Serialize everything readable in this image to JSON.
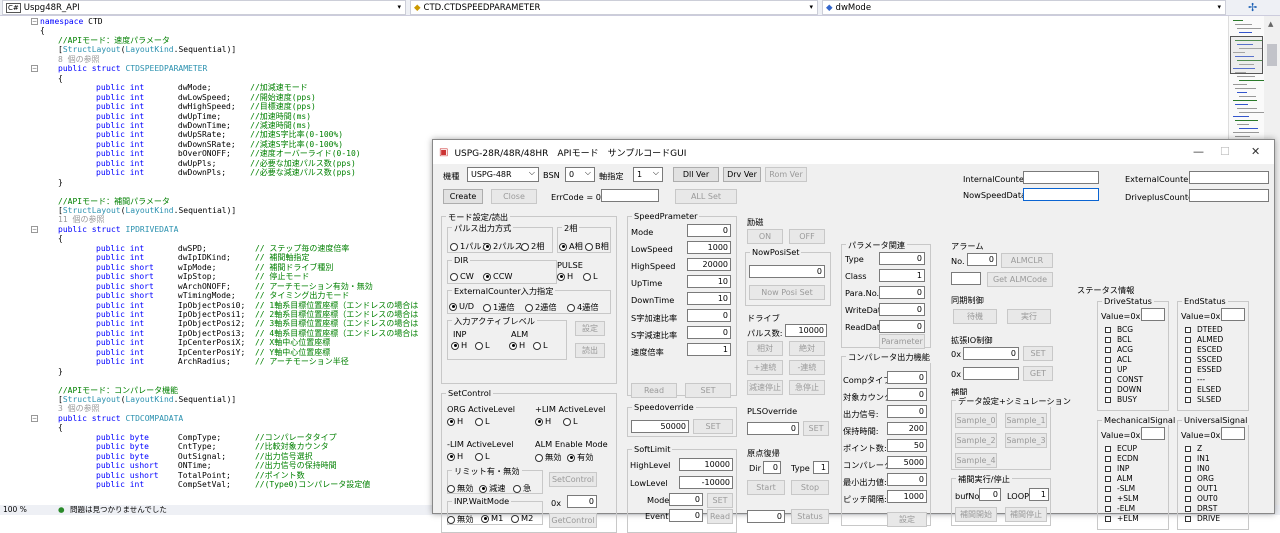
{
  "ide": {
    "project_dropdown": "Uspg48R_API",
    "class_dropdown": "CTD.CTDSPEEDPARAMETER",
    "member_dropdown": "dwMode",
    "zoom": "100 %",
    "status_text": "問題は見つかりませんでした"
  },
  "code": [
    {
      "y": 0,
      "parts": [
        [
          "kw",
          "namespace"
        ],
        [
          "",
          "CTD"
        ]
      ],
      "ind": 0
    },
    {
      "y": 1,
      "parts": [
        [
          "",
          "{"
        ]
      ],
      "ind": 0
    },
    {
      "y": 2,
      "parts": [
        [
          "cm",
          "//APIモード：速度パラメータ"
        ]
      ],
      "ind": 1
    },
    {
      "y": 3,
      "parts": [
        [
          "",
          "["
        ],
        [
          "ty",
          "StructLayout"
        ],
        [
          "",
          "("
        ],
        [
          "ty",
          "LayoutKind"
        ],
        [
          "",
          ".Sequential)]"
        ]
      ],
      "ind": 1
    },
    {
      "y": 4,
      "parts": [
        [
          "ref",
          "8 個の参照"
        ]
      ],
      "ind": 1
    },
    {
      "y": 5,
      "parts": [
        [
          "kw",
          "public struct"
        ],
        [
          "ty",
          "CTDSPEEDPARAMETER"
        ]
      ],
      "ind": 1
    },
    {
      "y": 6,
      "parts": [
        [
          "",
          "{"
        ]
      ],
      "ind": 1
    },
    {
      "y": 7,
      "parts": [
        [
          "kw",
          "public int"
        ],
        [
          "",
          "      dwMode;        "
        ],
        [
          "cm",
          "//加減速モード"
        ]
      ],
      "ind": 2
    },
    {
      "y": 8,
      "parts": [
        [
          "kw",
          "public int"
        ],
        [
          "",
          "      dwLowSpeed;    "
        ],
        [
          "cm",
          "//開始速度(pps)"
        ]
      ],
      "ind": 2
    },
    {
      "y": 9,
      "parts": [
        [
          "kw",
          "public int"
        ],
        [
          "",
          "      dwHighSpeed;   "
        ],
        [
          "cm",
          "//目標速度(pps)"
        ]
      ],
      "ind": 2
    },
    {
      "y": 10,
      "parts": [
        [
          "kw",
          "public int"
        ],
        [
          "",
          "      dwUpTime;      "
        ],
        [
          "cm",
          "//加速時間(ms)"
        ]
      ],
      "ind": 2
    },
    {
      "y": 11,
      "parts": [
        [
          "kw",
          "public int"
        ],
        [
          "",
          "      dwDownTime;    "
        ],
        [
          "cm",
          "//減速時間(ms)"
        ]
      ],
      "ind": 2
    },
    {
      "y": 12,
      "parts": [
        [
          "kw",
          "public int"
        ],
        [
          "",
          "      dwUpSRate;     "
        ],
        [
          "cm",
          "//加速S字比率(0-100%)"
        ]
      ],
      "ind": 2
    },
    {
      "y": 13,
      "parts": [
        [
          "kw",
          "public int"
        ],
        [
          "",
          "      dwDownSRate;   "
        ],
        [
          "cm",
          "//減速S字比率(0-100%)"
        ]
      ],
      "ind": 2
    },
    {
      "y": 14,
      "parts": [
        [
          "kw",
          "public int"
        ],
        [
          "",
          "      bOverONOFF;    "
        ],
        [
          "cm",
          "//速度オーバーライド(0-10)"
        ]
      ],
      "ind": 2
    },
    {
      "y": 15,
      "parts": [
        [
          "kw",
          "public int"
        ],
        [
          "",
          "      dwUpPls;       "
        ],
        [
          "cm",
          "//必要な加速パルス数(pps)"
        ]
      ],
      "ind": 2
    },
    {
      "y": 16,
      "parts": [
        [
          "kw",
          "public int"
        ],
        [
          "",
          "      dwDownPls;     "
        ],
        [
          "cm",
          "//必要な減速パルス数(pps)"
        ]
      ],
      "ind": 2
    },
    {
      "y": 17,
      "parts": [
        [
          "",
          "}"
        ]
      ],
      "ind": 1
    },
    {
      "y": 19,
      "parts": [
        [
          "cm",
          "//APIモード：補間パラメータ"
        ]
      ],
      "ind": 1
    },
    {
      "y": 20,
      "parts": [
        [
          "",
          "["
        ],
        [
          "ty",
          "StructLayout"
        ],
        [
          "",
          "("
        ],
        [
          "ty",
          "LayoutKind"
        ],
        [
          "",
          ".Sequential)]"
        ]
      ],
      "ind": 1
    },
    {
      "y": 21,
      "parts": [
        [
          "ref",
          "11 個の参照"
        ]
      ],
      "ind": 1
    },
    {
      "y": 22,
      "parts": [
        [
          "kw",
          "public struct"
        ],
        [
          "ty",
          "IPDRIVEDATA"
        ]
      ],
      "ind": 1
    },
    {
      "y": 23,
      "parts": [
        [
          "",
          "{"
        ]
      ],
      "ind": 1
    },
    {
      "y": 24,
      "parts": [
        [
          "kw",
          "public int"
        ],
        [
          "",
          "      dwSPD;          "
        ],
        [
          "cm",
          "// ステップ毎の速度倍率"
        ]
      ],
      "ind": 2
    },
    {
      "y": 25,
      "parts": [
        [
          "kw",
          "public int"
        ],
        [
          "",
          "      dwIpIDKind;     "
        ],
        [
          "cm",
          "// 補間軸指定"
        ]
      ],
      "ind": 2
    },
    {
      "y": 26,
      "parts": [
        [
          "kw",
          "public short"
        ],
        [
          "",
          "    wIpMode;        "
        ],
        [
          "cm",
          "// 補間ドライブ種別"
        ]
      ],
      "ind": 2
    },
    {
      "y": 27,
      "parts": [
        [
          "kw",
          "public short"
        ],
        [
          "",
          "    wIpStop;        "
        ],
        [
          "cm",
          "// 停止モード"
        ]
      ],
      "ind": 2
    },
    {
      "y": 28,
      "parts": [
        [
          "kw",
          "public short"
        ],
        [
          "",
          "    wArchONOFF;     "
        ],
        [
          "cm",
          "// アーチモーション有効・無効"
        ]
      ],
      "ind": 2
    },
    {
      "y": 29,
      "parts": [
        [
          "kw",
          "public short"
        ],
        [
          "",
          "    wTimingMode;    "
        ],
        [
          "cm",
          "// タイミング出力モード"
        ]
      ],
      "ind": 2
    },
    {
      "y": 30,
      "parts": [
        [
          "kw",
          "public int"
        ],
        [
          "",
          "      IpObjectPosi0;  "
        ],
        [
          "cm",
          "// 1軸系目標位置座標（エンドレスの場合は"
        ]
      ],
      "ind": 2
    },
    {
      "y": 31,
      "parts": [
        [
          "kw",
          "public int"
        ],
        [
          "",
          "      IpObjectPosi1;  "
        ],
        [
          "cm",
          "// 2軸系目標位置座標（エンドレスの場合は"
        ]
      ],
      "ind": 2
    },
    {
      "y": 32,
      "parts": [
        [
          "kw",
          "public int"
        ],
        [
          "",
          "      IpObjectPosi2;  "
        ],
        [
          "cm",
          "// 3軸系目標位置座標（エンドレスの場合は"
        ]
      ],
      "ind": 2
    },
    {
      "y": 33,
      "parts": [
        [
          "kw",
          "public int"
        ],
        [
          "",
          "      IpObjectPosi3;  "
        ],
        [
          "cm",
          "// 4軸系目標位置座標（エンドレスの場合は"
        ]
      ],
      "ind": 2
    },
    {
      "y": 34,
      "parts": [
        [
          "kw",
          "public int"
        ],
        [
          "",
          "      IpCenterPosiX;  "
        ],
        [
          "cm",
          "// X軸中心位置座標"
        ]
      ],
      "ind": 2
    },
    {
      "y": 35,
      "parts": [
        [
          "kw",
          "public int"
        ],
        [
          "",
          "      IpCenterPosiY;  "
        ],
        [
          "cm",
          "// Y軸中心位置座標"
        ]
      ],
      "ind": 2
    },
    {
      "y": 36,
      "parts": [
        [
          "kw",
          "public int"
        ],
        [
          "",
          "      ArchRadius;     "
        ],
        [
          "cm",
          "// アーチモーション半径"
        ]
      ],
      "ind": 2
    },
    {
      "y": 37,
      "parts": [
        [
          "",
          "}"
        ]
      ],
      "ind": 1
    },
    {
      "y": 39,
      "parts": [
        [
          "cm",
          "//APIモード：コンパレータ機能"
        ]
      ],
      "ind": 1
    },
    {
      "y": 40,
      "parts": [
        [
          "",
          "["
        ],
        [
          "ty",
          "StructLayout"
        ],
        [
          "",
          "("
        ],
        [
          "ty",
          "LayoutKind"
        ],
        [
          "",
          ".Sequential)]"
        ]
      ],
      "ind": 1
    },
    {
      "y": 41,
      "parts": [
        [
          "ref",
          "3 個の参照"
        ]
      ],
      "ind": 1
    },
    {
      "y": 42,
      "parts": [
        [
          "kw",
          "public struct"
        ],
        [
          "ty",
          "CTDCOMPADATA"
        ]
      ],
      "ind": 1
    },
    {
      "y": 43,
      "parts": [
        [
          "",
          "{"
        ]
      ],
      "ind": 1
    },
    {
      "y": 44,
      "parts": [
        [
          "kw",
          "public byte"
        ],
        [
          "",
          "     CompType;       "
        ],
        [
          "cm",
          "//コンパレータタイプ"
        ]
      ],
      "ind": 2
    },
    {
      "y": 45,
      "parts": [
        [
          "kw",
          "public byte"
        ],
        [
          "",
          "     CntType;        "
        ],
        [
          "cm",
          "//比較対象カウンタ"
        ]
      ],
      "ind": 2
    },
    {
      "y": 46,
      "parts": [
        [
          "kw",
          "public byte"
        ],
        [
          "",
          "     OutSignal;      "
        ],
        [
          "cm",
          "//出力信号選択"
        ]
      ],
      "ind": 2
    },
    {
      "y": 47,
      "parts": [
        [
          "kw",
          "public ushort"
        ],
        [
          "",
          "   ONTime;         "
        ],
        [
          "cm",
          "//出力信号の保持時間"
        ]
      ],
      "ind": 2
    },
    {
      "y": 48,
      "parts": [
        [
          "kw",
          "public ushort"
        ],
        [
          "",
          "   TotalPoint;     "
        ],
        [
          "cm",
          "//ポイント数"
        ]
      ],
      "ind": 2
    },
    {
      "y": 49,
      "parts": [
        [
          "kw",
          "public int"
        ],
        [
          "",
          "      CompSetVal;     "
        ],
        [
          "cm",
          "//(Type0)コンパレータ設定値"
        ]
      ],
      "ind": 2
    }
  ],
  "app": {
    "title": "USPG-28R/48R/48HR　APIモード　サンプルコードGUI",
    "model_label": "機種",
    "model_value": "USPG-48R",
    "bsn_label": "BSN",
    "bsn_value": "0",
    "axis_label": "軸指定",
    "axis_value": "1",
    "dll_ver": "Dll Ver",
    "drv_ver": "Drv Ver",
    "rom_ver": "Rom Ver",
    "create": "Create",
    "close": "Close",
    "errcode_label": "ErrCode = 0x",
    "all_set": "ALL Set",
    "internal_counter": "InternalCounter",
    "external_counter": "ExternalCounter",
    "now_speed_data": "NowSpeedData",
    "driveplus_counter": "DriveplusCounter",
    "mode_group": "モード設定/読出",
    "pulse_group": "パルス出力方式",
    "pulse_opts": [
      "1パルス",
      "2パルス",
      "2相"
    ],
    "phase2_group": "2相",
    "phase2_opts": [
      "A相",
      "B相"
    ],
    "dir_group": "DIR",
    "dir_opts": [
      "CW",
      "CCW"
    ],
    "pulse_lbl": "PULSE",
    "hl": [
      "H",
      "L"
    ],
    "ext_group": "ExternalCounter入力指定",
    "ext_opts": [
      "U/D",
      "1逓倍",
      "2逓倍",
      "4逓倍"
    ],
    "active_group": "入力アクティブレベル",
    "inp": "INP",
    "alm": "ALM",
    "set_jp": "設定",
    "read_jp": "読出",
    "setcontrol_group": "SetControl",
    "org_active": "ORG ActiveLevel",
    "plim_active": "+LIM ActiveLevel",
    "mlim_active": "-LIM ActiveLevel",
    "alm_enable": "ALM Enable Mode",
    "alm_enable_opts": [
      "無効",
      "有効"
    ],
    "limit_group": "リミット有・無効",
    "limit_opts": [
      "無効",
      "減速",
      "急"
    ],
    "setcontrol_btn": "SetControl",
    "zero_x": "0x",
    "zero_x_val": "0",
    "inpwait_group": "INP.WaitMode",
    "inpwait_opts": [
      "無効",
      "M1",
      "M2"
    ],
    "getcontrol_btn": "GetControl",
    "speed_group": "SpeedPrameter",
    "speed_fields": [
      {
        "label": "Mode",
        "value": "0"
      },
      {
        "label": "LowSpeed",
        "value": "1000"
      },
      {
        "label": "HighSpeed",
        "value": "20000"
      },
      {
        "label": "UpTime",
        "value": "10"
      },
      {
        "label": "DownTime",
        "value": "10"
      },
      {
        "label": "S字加速比率",
        "value": "0"
      },
      {
        "label": "S字減速比率",
        "value": "0"
      },
      {
        "label": "速度倍率",
        "value": "1"
      }
    ],
    "read": "Read",
    "set": "SET",
    "override_group": "Speedoverride",
    "override_value": "50000",
    "softlimit_group": "SoftLimit",
    "highlevel_label": "HighLevel",
    "highlevel_value": "10000",
    "lowlevel_label": "LowLevel",
    "lowlevel_value": "-10000",
    "sl_mode_label": "Mode",
    "sl_mode_value": "0",
    "sl_event_label": "Event",
    "sl_event_value": "0",
    "excite_group": "励磁",
    "on": "ON",
    "off": "OFF",
    "nowposi_group": "NowPosiSet",
    "nowposi_value": "0",
    "nowposi_btn": "Now Posi Set",
    "drive_group": "ドライブ",
    "pulse_count_label": "パルス数:",
    "pulse_count_value": "10000",
    "relative": "相対",
    "absolute": "絶対",
    "plus_cont": "+連続",
    "minus_cont": "-連続",
    "decel_stop": "減速停止",
    "emerg_stop": "急停止",
    "plsoverride_group": "PLSOverride",
    "plsoverride_value": "0",
    "origin_group": "原点復帰",
    "dir_short": "Dir",
    "dir_val": "0",
    "type_label": "Type",
    "type_val": "1",
    "start": "Start",
    "stop": "Stop",
    "status_val": "0",
    "status_btn": "Status",
    "param_group": "パラメータ関連",
    "param_fields": [
      {
        "label": "Type",
        "value": "0"
      },
      {
        "label": "Class",
        "value": "1"
      },
      {
        "label": "Para.No.",
        "value": "0"
      },
      {
        "label": "WriteData",
        "value": "0"
      },
      {
        "label": "ReadData",
        "value": "0"
      }
    ],
    "parameter_btn": "Parameter",
    "comp_group": "コンパレータ出力機能",
    "comp_fields": [
      {
        "label": "Compタイプ:",
        "value": "0"
      },
      {
        "label": "対象カウンタ:",
        "value": "0"
      },
      {
        "label": "出力信号:",
        "value": "0"
      },
      {
        "label": "保持時間:",
        "value": "200"
      },
      {
        "label": "ポイント数:",
        "value": "50"
      },
      {
        "label": "コンパレータ値:",
        "value": "5000"
      },
      {
        "label": "最小出力値:",
        "value": "0"
      },
      {
        "label": "ピッチ間隔:",
        "value": "1000"
      }
    ],
    "settei": "設定",
    "alarm_group": "アラーム",
    "alarm_no": "No.",
    "alarm_no_value": "0",
    "almclr": "ALMCLR",
    "get_almcode": "Get ALMCode",
    "sync_group": "同期制御",
    "taiki": "待機",
    "jikko": "実行",
    "ext_io_group": "拡張IO制御",
    "ext_io_value": "0",
    "set_btn": "SET",
    "get_btn": "GET",
    "interp_group": "補間",
    "dataset_group": "データ設定+シミュレーション",
    "samples": [
      "Sample_0",
      "Sample_1",
      "Sample_2",
      "Sample_3",
      "Sample_4"
    ],
    "interp_exec_group": "補間実行/停止",
    "bufno_label": "bufNo.",
    "bufno_value": "0",
    "loop_label": "LOOP",
    "loop_value": "1",
    "interp_start": "補間開始",
    "interp_stop": "補間停止",
    "status_group": "ステータス情報",
    "drive_status": "DriveStatus",
    "drive_status_items": [
      "BCG",
      "BCL",
      "ACG",
      "ACL",
      "UP",
      "CONST",
      "DOWN",
      "BUSY"
    ],
    "end_status": "EndStatus",
    "end_status_items": [
      "DTEED",
      "ALMED",
      "ESCED",
      "SSCED",
      "ESSED",
      "---",
      "ELSED",
      "SLSED"
    ],
    "value_label": "Value=0x",
    "mech_signal": "MechanicalSignal",
    "mech_items": [
      "ECUP",
      "ECDN",
      "INP",
      "ALM",
      "-SLM",
      "+SLM",
      "-ELM",
      "+ELM"
    ],
    "univ_signal": "UniversalSignal",
    "univ_items": [
      "Z",
      "IN1",
      "IN0",
      "ORG",
      "OUT1",
      "OUT0",
      "DRST",
      "DRIVE"
    ]
  }
}
